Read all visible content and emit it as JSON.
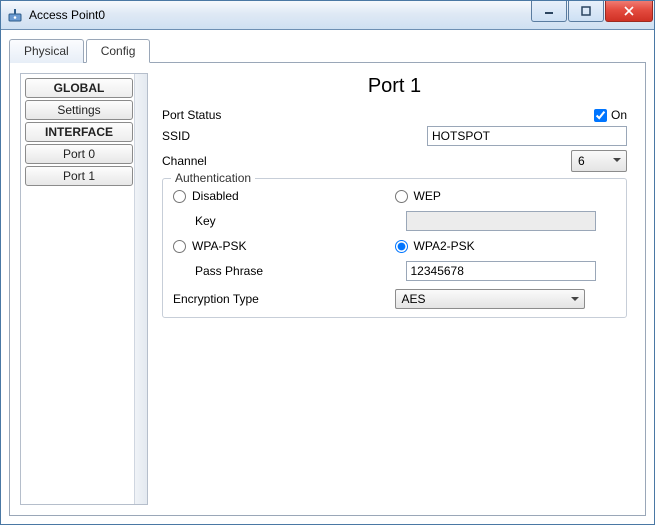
{
  "window": {
    "title": "Access Point0"
  },
  "tabs": {
    "physical": "Physical",
    "config": "Config"
  },
  "sidebar": {
    "global_header": "GLOBAL",
    "settings": "Settings",
    "interface_header": "INTERFACE",
    "port0": "Port 0",
    "port1": "Port 1"
  },
  "main": {
    "heading": "Port 1",
    "port_status_label": "Port Status",
    "on_label": "On",
    "ssid_label": "SSID",
    "ssid_value": "HOTSPOT",
    "channel_label": "Channel",
    "channel_value": "6",
    "auth": {
      "legend": "Authentication",
      "disabled": "Disabled",
      "wep": "WEP",
      "key_label": "Key",
      "key_value": "",
      "wpa_psk": "WPA-PSK",
      "wpa2_psk": "WPA2-PSK",
      "pass_label": "Pass Phrase",
      "pass_value": "12345678",
      "enc_label": "Encryption Type",
      "enc_value": "AES",
      "selected": "wpa2"
    }
  }
}
